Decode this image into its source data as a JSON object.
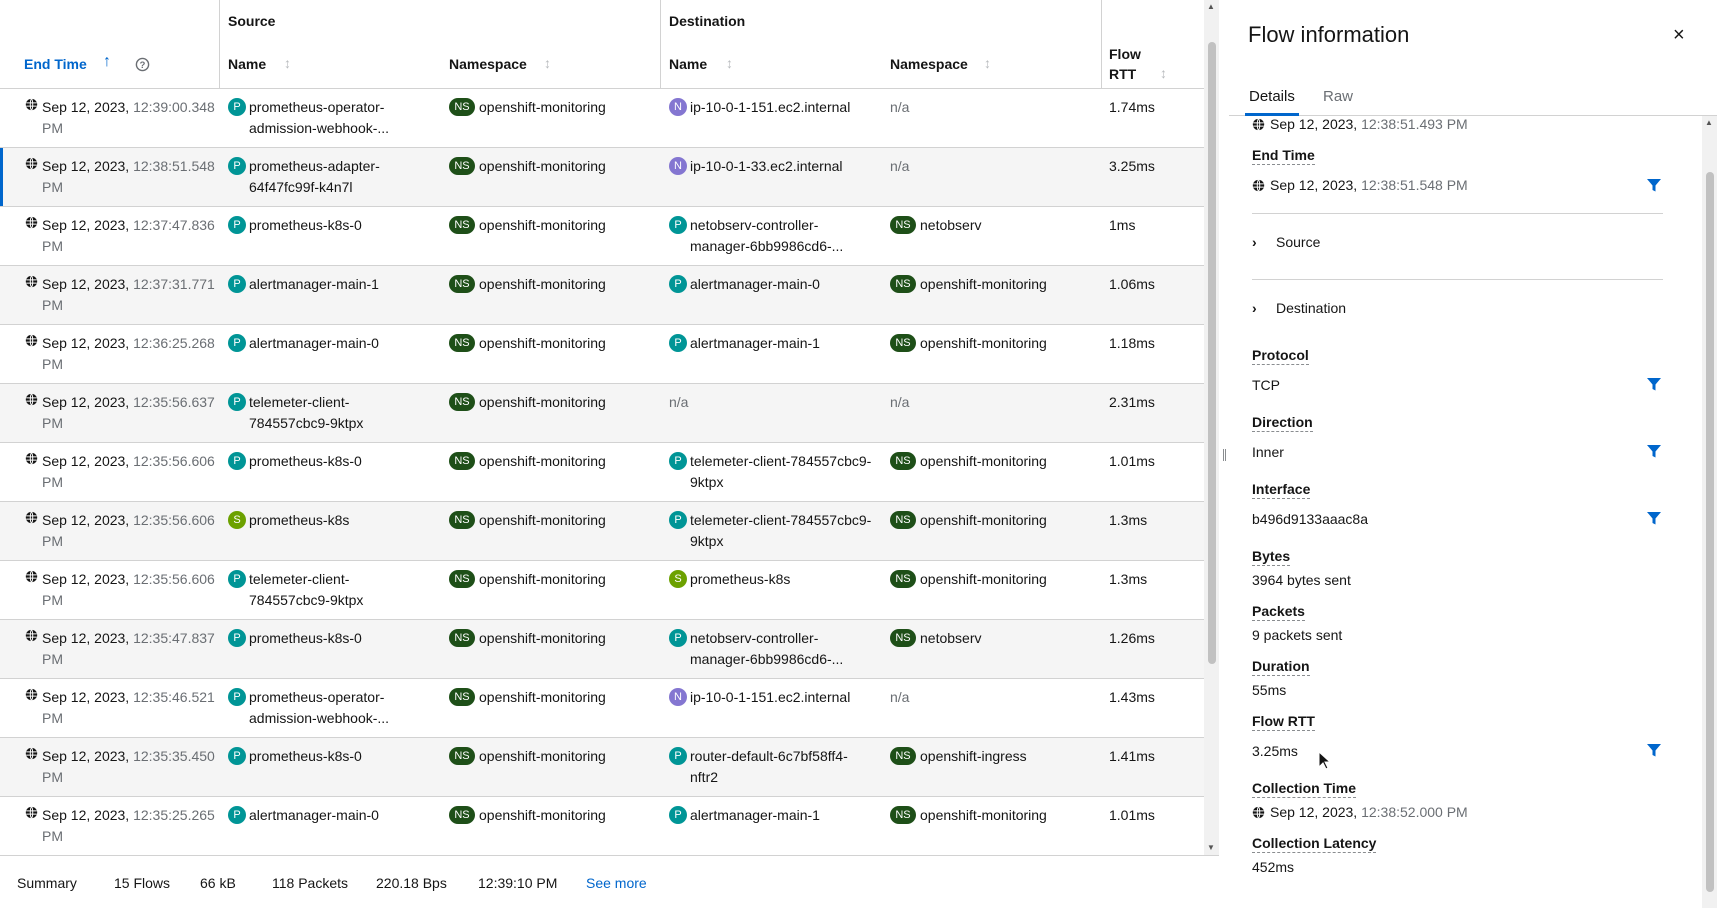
{
  "table": {
    "groups": {
      "source": "Source",
      "destination": "Destination"
    },
    "columns": {
      "end_time": "End Time",
      "src_name": "Name",
      "src_namespace": "Namespace",
      "dst_name": "Name",
      "dst_namespace": "Namespace",
      "flow_rtt_1": "Flow",
      "flow_rtt_2": "RTT"
    },
    "rows": [
      {
        "date": "Sep 12, 2023,",
        "time": "12:39:00.348",
        "ampm": "PM",
        "src_kind": "P",
        "src_name": "prometheus-operator-admission-webhook-...",
        "src_ns": "openshift-monitoring",
        "dst_kind": "N",
        "dst_name": "ip-10-0-1-151.ec2.internal",
        "dst_ns": "n/a",
        "dst_ns_kind": "",
        "rtt": "1.74ms"
      },
      {
        "date": "Sep 12, 2023,",
        "time": "12:38:51.548",
        "ampm": "PM",
        "src_kind": "P",
        "src_name": "prometheus-adapter-64f47fc99f-k4n7l",
        "src_ns": "openshift-monitoring",
        "dst_kind": "N",
        "dst_name": "ip-10-0-1-33.ec2.internal",
        "dst_ns": "n/a",
        "dst_ns_kind": "",
        "rtt": "3.25ms"
      },
      {
        "date": "Sep 12, 2023,",
        "time": "12:37:47.836",
        "ampm": "PM",
        "src_kind": "P",
        "src_name": "prometheus-k8s-0",
        "src_ns": "openshift-monitoring",
        "dst_kind": "P",
        "dst_name": "netobserv-controller-manager-6bb9986cd6-...",
        "dst_ns": "netobserv",
        "dst_ns_kind": "NS",
        "rtt": "1ms"
      },
      {
        "date": "Sep 12, 2023,",
        "time": "12:37:31.771",
        "ampm": "PM",
        "src_kind": "P",
        "src_name": "alertmanager-main-1",
        "src_ns": "openshift-monitoring",
        "dst_kind": "P",
        "dst_name": "alertmanager-main-0",
        "dst_ns": "openshift-monitoring",
        "dst_ns_kind": "NS",
        "rtt": "1.06ms"
      },
      {
        "date": "Sep 12, 2023,",
        "time": "12:36:25.268",
        "ampm": "PM",
        "src_kind": "P",
        "src_name": "alertmanager-main-0",
        "src_ns": "openshift-monitoring",
        "dst_kind": "P",
        "dst_name": "alertmanager-main-1",
        "dst_ns": "openshift-monitoring",
        "dst_ns_kind": "NS",
        "rtt": "1.18ms"
      },
      {
        "date": "Sep 12, 2023,",
        "time": "12:35:56.637",
        "ampm": "PM",
        "src_kind": "P",
        "src_name": "telemeter-client-784557cbc9-9ktpx",
        "src_ns": "openshift-monitoring",
        "dst_kind": "",
        "dst_name": "n/a",
        "dst_ns": "n/a",
        "dst_ns_kind": "",
        "rtt": "2.31ms"
      },
      {
        "date": "Sep 12, 2023,",
        "time": "12:35:56.606",
        "ampm": "PM",
        "src_kind": "P",
        "src_name": "prometheus-k8s-0",
        "src_ns": "openshift-monitoring",
        "dst_kind": "P",
        "dst_name": "telemeter-client-784557cbc9-9ktpx",
        "dst_ns": "openshift-monitoring",
        "dst_ns_kind": "NS",
        "rtt": "1.01ms"
      },
      {
        "date": "Sep 12, 2023,",
        "time": "12:35:56.606",
        "ampm": "PM",
        "src_kind": "S",
        "src_name": "prometheus-k8s",
        "src_ns": "openshift-monitoring",
        "dst_kind": "P",
        "dst_name": "telemeter-client-784557cbc9-9ktpx",
        "dst_ns": "openshift-monitoring",
        "dst_ns_kind": "NS",
        "rtt": "1.3ms"
      },
      {
        "date": "Sep 12, 2023,",
        "time": "12:35:56.606",
        "ampm": "PM",
        "src_kind": "P",
        "src_name": "telemeter-client-784557cbc9-9ktpx",
        "src_ns": "openshift-monitoring",
        "dst_kind": "S",
        "dst_name": "prometheus-k8s",
        "dst_ns": "openshift-monitoring",
        "dst_ns_kind": "NS",
        "rtt": "1.3ms"
      },
      {
        "date": "Sep 12, 2023,",
        "time": "12:35:47.837",
        "ampm": "PM",
        "src_kind": "P",
        "src_name": "prometheus-k8s-0",
        "src_ns": "openshift-monitoring",
        "dst_kind": "P",
        "dst_name": "netobserv-controller-manager-6bb9986cd6-...",
        "dst_ns": "netobserv",
        "dst_ns_kind": "NS",
        "rtt": "1.26ms"
      },
      {
        "date": "Sep 12, 2023,",
        "time": "12:35:46.521",
        "ampm": "PM",
        "src_kind": "P",
        "src_name": "prometheus-operator-admission-webhook-...",
        "src_ns": "openshift-monitoring",
        "dst_kind": "N",
        "dst_name": "ip-10-0-1-151.ec2.internal",
        "dst_ns": "n/a",
        "dst_ns_kind": "",
        "rtt": "1.43ms"
      },
      {
        "date": "Sep 12, 2023,",
        "time": "12:35:35.450",
        "ampm": "PM",
        "src_kind": "P",
        "src_name": "prometheus-k8s-0",
        "src_ns": "openshift-monitoring",
        "dst_kind": "P",
        "dst_name": "router-default-6c7bf58ff4-nftr2",
        "dst_ns": "openshift-ingress",
        "dst_ns_kind": "NS",
        "rtt": "1.41ms"
      },
      {
        "date": "Sep 12, 2023,",
        "time": "12:35:25.265",
        "ampm": "PM",
        "src_kind": "P",
        "src_name": "alertmanager-main-0",
        "src_ns": "openshift-monitoring",
        "dst_kind": "P",
        "dst_name": "alertmanager-main-1",
        "dst_ns": "openshift-monitoring",
        "dst_ns_kind": "NS",
        "rtt": "1.01ms"
      }
    ]
  },
  "summary": {
    "label": "Summary",
    "flows": "15 Flows",
    "size": "66 kB",
    "packets": "118 Packets",
    "rate": "220.18 Bps",
    "time": "12:39:10 PM",
    "see_more": "See more"
  },
  "panel": {
    "title": "Flow information",
    "close": "×",
    "tabs": {
      "details": "Details",
      "raw": "Raw"
    },
    "start_date": "Sep 12, 2023,",
    "start_time": "12:38:51.493 PM",
    "end_time_label": "End Time",
    "end_date": "Sep 12, 2023,",
    "end_time": "12:38:51.548 PM",
    "source_label": "Source",
    "destination_label": "Destination",
    "protocol_label": "Protocol",
    "protocol": "TCP",
    "direction_label": "Direction",
    "direction": "Inner",
    "interface_label": "Interface",
    "interface": "b496d9133aaac8a",
    "bytes_label": "Bytes",
    "bytes": "3964 bytes sent",
    "packets_label": "Packets",
    "packets": "9 packets sent",
    "duration_label": "Duration",
    "duration": "55ms",
    "flow_rtt_label": "Flow RTT",
    "flow_rtt": "3.25ms",
    "collection_time_label": "Collection Time",
    "collection_date": "Sep 12, 2023,",
    "collection_time": "12:38:52.000 PM",
    "collection_latency_label": "Collection Latency",
    "collection_latency": "452ms"
  },
  "colors": {
    "accent": "#0066cc",
    "pod": "#009596",
    "node": "#8476d1",
    "service": "#6ca100",
    "namespace": "#1e4f18"
  }
}
